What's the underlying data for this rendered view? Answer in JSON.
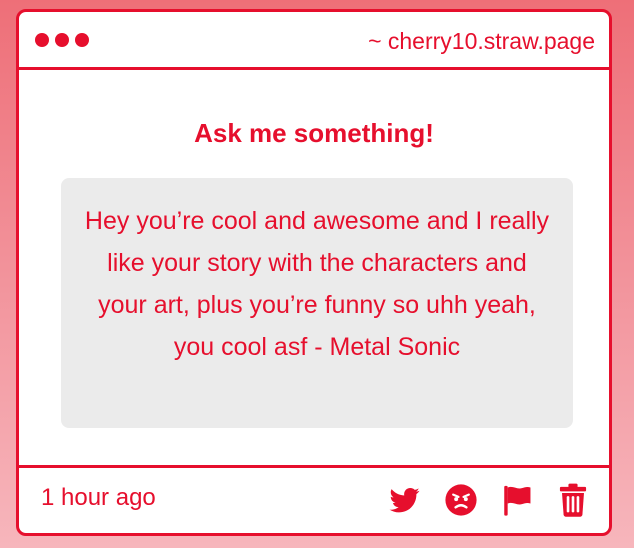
{
  "window": {
    "site_url": "~ cherry10.straw.page"
  },
  "main": {
    "heading": "Ask me something!",
    "message": "Hey you’re cool and awesome and I really like your story with the characters and your art, plus you’re funny so uhh yeah, you cool asf - Metal Sonic"
  },
  "footer": {
    "timestamp": "1 hour ago",
    "actions": [
      "twitter-icon",
      "angry-face-icon",
      "flag-icon",
      "trash-icon"
    ]
  },
  "colors": {
    "accent": "#e60f2d",
    "card_bg": "#ffffff",
    "message_bg": "#ebebeb",
    "page_bg_top": "#ee6f78",
    "page_bg_bottom": "#f7b6bc"
  }
}
